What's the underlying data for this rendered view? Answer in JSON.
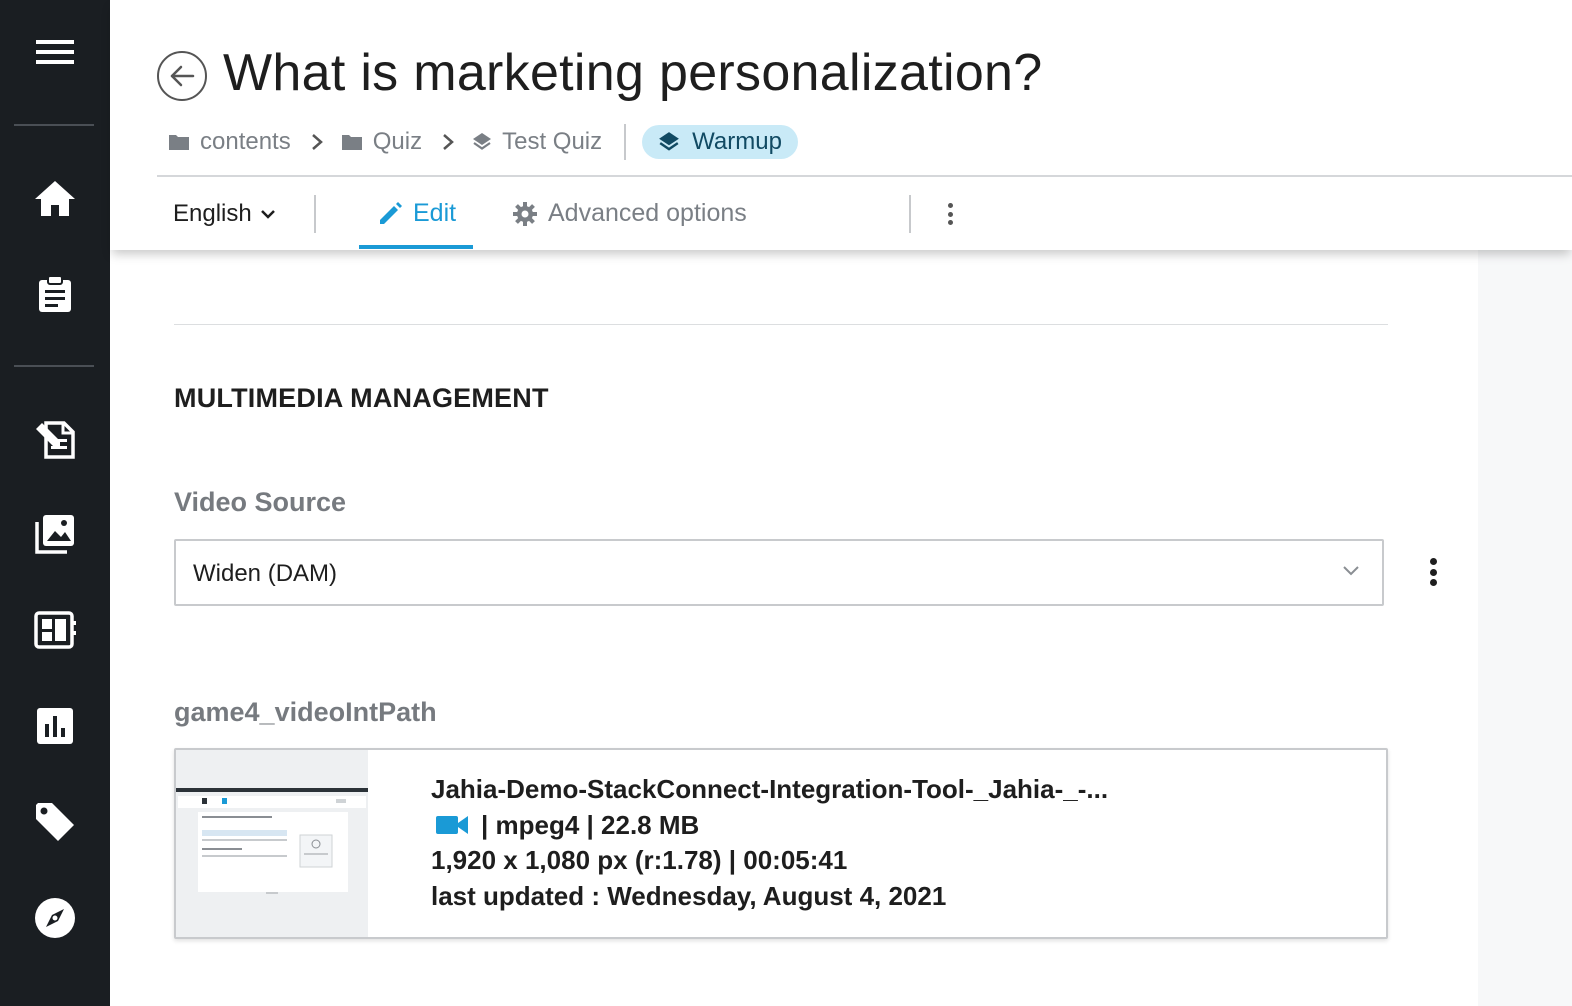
{
  "sidebar": {
    "items": [
      {
        "icon": "menu-icon"
      },
      {
        "icon": "home-icon"
      },
      {
        "icon": "clipboard-icon"
      },
      {
        "icon": "content-editor-icon"
      },
      {
        "icon": "media-library-icon"
      },
      {
        "icon": "dashboard-icon"
      },
      {
        "icon": "analytics-icon"
      },
      {
        "icon": "tag-icon"
      },
      {
        "icon": "compass-icon"
      }
    ]
  },
  "header": {
    "title": "What is marketing personalization?",
    "breadcrumb": [
      {
        "label": "contents",
        "icon": "folder-icon"
      },
      {
        "label": "Quiz",
        "icon": "folder-icon"
      },
      {
        "label": "Test Quiz",
        "icon": "layers-icon"
      }
    ],
    "current": {
      "label": "Warmup",
      "icon": "layers-icon"
    }
  },
  "toolbar": {
    "language": "English",
    "edit_label": "Edit",
    "advanced_label": "Advanced options"
  },
  "main": {
    "section_title": "MULTIMEDIA MANAGEMENT",
    "video_source": {
      "label": "Video Source",
      "value": "Widen (DAM)"
    },
    "video_field": {
      "label": "game4_videoIntPath",
      "file_name": "Jahia-Demo-StackConnect-Integration-Tool-_Jahia-_-...",
      "format_size": "| mpeg4 | 22.8 MB",
      "dimensions_duration": "1,920 x 1,080 px (r:1.78) | 00:05:41",
      "last_updated": "last updated : Wednesday, August 4, 2021"
    }
  },
  "colors": {
    "sidebar_bg": "#1a1e22",
    "accent": "#1a9ad6",
    "pill_bg": "#c9eaf7",
    "pill_text": "#114a63",
    "muted_text": "#7a7f85"
  }
}
